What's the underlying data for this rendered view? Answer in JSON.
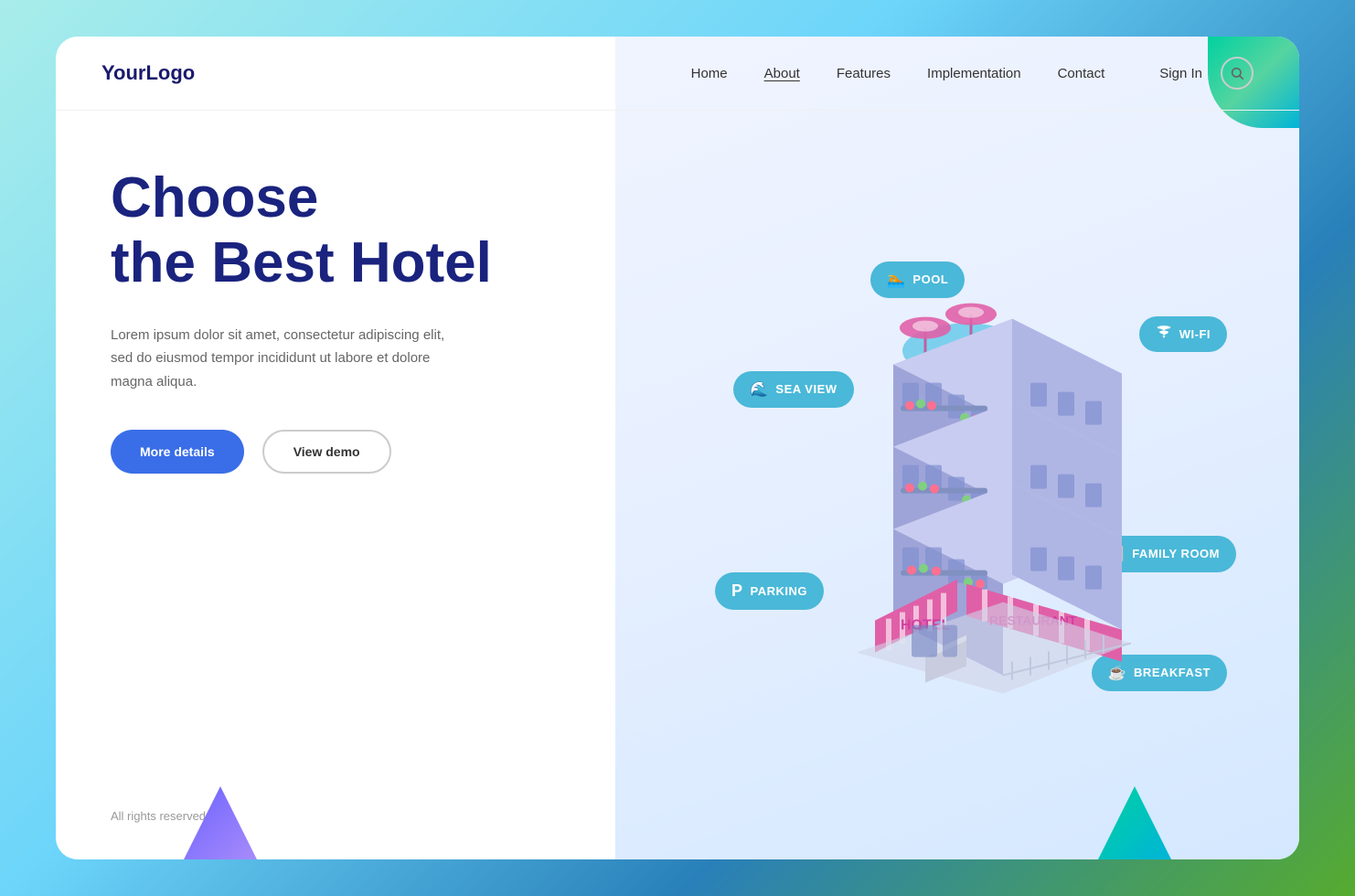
{
  "logo": "YourLogo",
  "nav": {
    "links": [
      {
        "label": "Home",
        "active": false
      },
      {
        "label": "About",
        "active": true
      },
      {
        "label": "Features",
        "active": false
      },
      {
        "label": "Implementation",
        "active": false
      },
      {
        "label": "Contact",
        "active": false
      }
    ],
    "signIn": "Sign In"
  },
  "hero": {
    "title": "Choose\nthe Best Hotel",
    "description": "Lorem ipsum dolor sit amet, consectetur adipiscing elit, sed do eiusmod tempor incididunt ut labore et dolore magna aliqua.",
    "btn_primary": "More details",
    "btn_secondary": "View demo"
  },
  "badges": [
    {
      "id": "pool",
      "label": "POOL",
      "icon": "🏊"
    },
    {
      "id": "seaview",
      "label": "SEA VIEW",
      "icon": "🌊"
    },
    {
      "id": "wifi",
      "label": "WI-FI",
      "icon": "📶"
    },
    {
      "id": "parking",
      "label": "PARKING",
      "icon": "P"
    },
    {
      "id": "family",
      "label": "FAMILY ROOM",
      "icon": "👶"
    },
    {
      "id": "breakfast",
      "label": "BREAKFAST",
      "icon": "☕"
    }
  ],
  "footer": {
    "copyright": "All rights reserved"
  },
  "colors": {
    "accent_blue": "#3a6ee8",
    "dark_navy": "#1a237e",
    "badge_color": "#4ab8d8"
  }
}
